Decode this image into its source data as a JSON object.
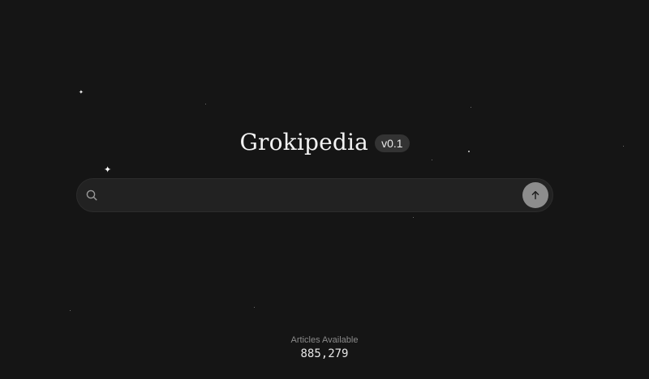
{
  "app": {
    "title": "Grokipedia",
    "version": "v0.1"
  },
  "search": {
    "placeholder": "",
    "value": "",
    "icon": "search-icon",
    "submit_icon": "arrow-up-icon"
  },
  "stats": {
    "label": "Articles Available",
    "count": "885,279"
  },
  "colors": {
    "background": "#151515",
    "search_bg": "#222222",
    "badge_bg": "#333333",
    "submit_bg": "#8d8d8d"
  }
}
